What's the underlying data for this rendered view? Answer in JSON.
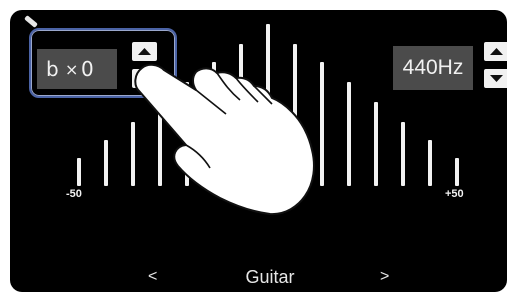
{
  "tuning": {
    "symbol": "b",
    "multiplier": "×",
    "value": "0"
  },
  "frequency": {
    "label": "440Hz"
  },
  "meter": {
    "min_label": "-50",
    "max_label": "+50"
  },
  "instrument": {
    "prev": "<",
    "name": "Guitar",
    "next": ">"
  },
  "colors": {
    "highlight": "#4b63a6",
    "screen": "#000000",
    "box": "#4b4b4b"
  },
  "icons": [
    "back-icon",
    "up-arrow-icon",
    "down-arrow-icon",
    "pointing-hand-icon"
  ]
}
